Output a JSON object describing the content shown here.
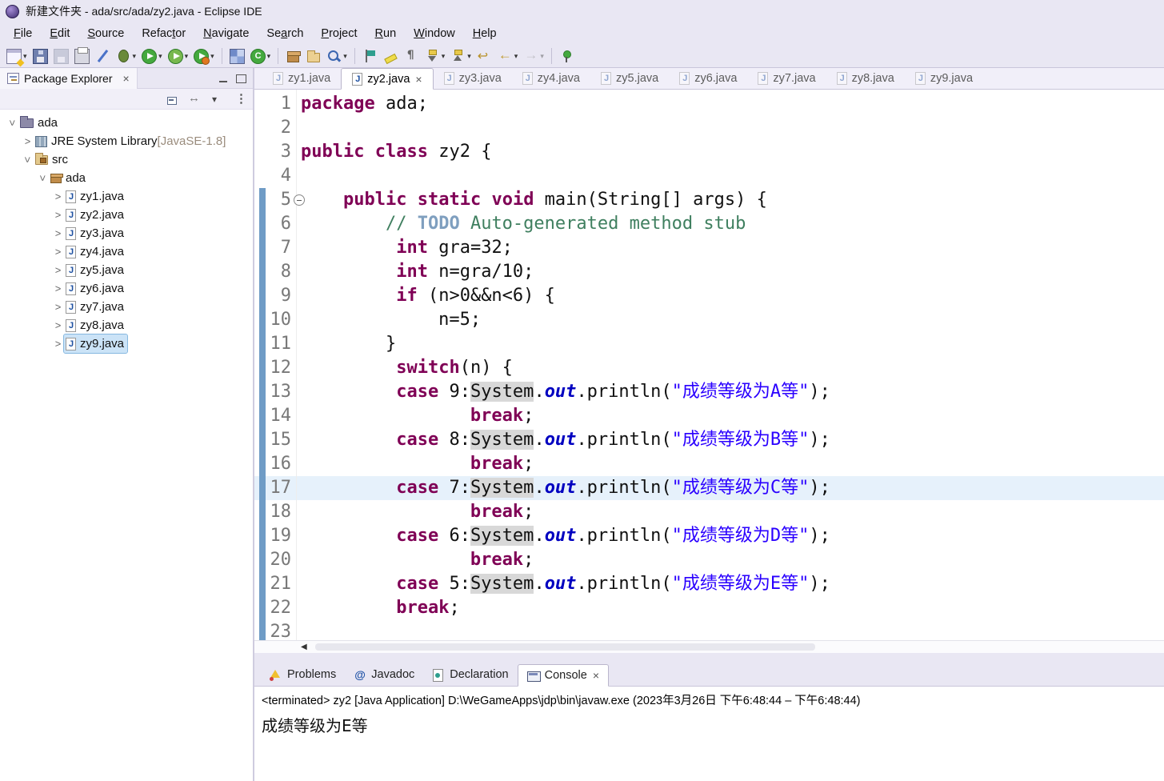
{
  "window": {
    "title": "新建文件夹 - ada/src/ada/zy2.java - Eclipse IDE"
  },
  "icons": {
    "close": "×",
    "dropdown": "▾",
    "expander": ">",
    "scroll_left": "◀"
  },
  "colors": {
    "keyword": "#7f0055",
    "string": "#2a00ff",
    "comment": "#3f7f5f",
    "task_tag": "#7f9fbf",
    "field": "#0000c0",
    "current_line": "#e6f1fb",
    "occurrence": "#d8d8d8",
    "chrome": "#e9e7f3"
  },
  "menubar": [
    {
      "label": "File",
      "m": 0
    },
    {
      "label": "Edit",
      "m": 0
    },
    {
      "label": "Source",
      "m": 0
    },
    {
      "label": "Refactor",
      "m": 5
    },
    {
      "label": "Navigate",
      "m": 0
    },
    {
      "label": "Search",
      "m": 2
    },
    {
      "label": "Project",
      "m": 0
    },
    {
      "label": "Run",
      "m": 0
    },
    {
      "label": "Window",
      "m": 0
    },
    {
      "label": "Help",
      "m": 0
    }
  ],
  "toolbar": [
    {
      "name": "new",
      "kind": "window",
      "dd": true
    },
    {
      "name": "save",
      "kind": "floppy"
    },
    {
      "name": "save-all",
      "kind": "floppy2",
      "disabled": true
    },
    {
      "name": "print",
      "kind": "printer"
    },
    {
      "name": "skip-all-breakpoints",
      "kind": "slash"
    },
    {
      "name": "debug",
      "kind": "bug",
      "dd": true
    },
    {
      "name": "run",
      "kind": "run",
      "dd": true
    },
    {
      "name": "coverage",
      "kind": "coverage",
      "dd": true
    },
    {
      "name": "profile",
      "kind": "profile",
      "dd": true
    },
    {
      "sep": true
    },
    {
      "name": "new-java-project",
      "kind": "grid"
    },
    {
      "name": "new-java-class",
      "kind": "class",
      "dd": true
    },
    {
      "sep": true
    },
    {
      "name": "new-package",
      "kind": "package"
    },
    {
      "name": "open-type",
      "kind": "folder"
    },
    {
      "name": "search",
      "kind": "search",
      "dd": true
    },
    {
      "sep": true
    },
    {
      "name": "open-perspective",
      "kind": "flag"
    },
    {
      "name": "mark-occurrences",
      "kind": "marker"
    },
    {
      "name": "show-whitespace",
      "kind": "pilcrow"
    },
    {
      "name": "next-annotation",
      "kind": "chevdown",
      "dd": true
    },
    {
      "name": "previous-annotation",
      "kind": "chevup",
      "dd": true
    },
    {
      "name": "last-edit-location",
      "kind": "undo"
    },
    {
      "name": "back",
      "kind": "arrowleft",
      "dd": true
    },
    {
      "name": "forward",
      "kind": "arrowright",
      "dd": true,
      "disabled": true
    },
    {
      "sep": true
    },
    {
      "name": "pin-editor",
      "kind": "pin"
    }
  ],
  "package_explorer": {
    "title": "Package Explorer",
    "tree": [
      {
        "label": "ada",
        "depth": 0,
        "exp": "open",
        "icon": "project"
      },
      {
        "label": "JRE System Library",
        "dec": " [JavaSE-1.8]",
        "depth": 1,
        "exp": "closed",
        "icon": "library"
      },
      {
        "label": "src",
        "depth": 1,
        "exp": "open",
        "icon": "srcfolder"
      },
      {
        "label": "ada",
        "depth": 2,
        "exp": "open",
        "icon": "package"
      },
      {
        "label": "zy1.java",
        "depth": 3,
        "exp": "closed",
        "icon": "jfile"
      },
      {
        "label": "zy2.java",
        "depth": 3,
        "exp": "closed",
        "icon": "jfile"
      },
      {
        "label": "zy3.java",
        "depth": 3,
        "exp": "closed",
        "icon": "jfile"
      },
      {
        "label": "zy4.java",
        "depth": 3,
        "exp": "closed",
        "icon": "jfile"
      },
      {
        "label": "zy5.java",
        "depth": 3,
        "exp": "closed",
        "icon": "jfile"
      },
      {
        "label": "zy6.java",
        "depth": 3,
        "exp": "closed",
        "icon": "jfile"
      },
      {
        "label": "zy7.java",
        "depth": 3,
        "exp": "closed",
        "icon": "jfile"
      },
      {
        "label": "zy8.java",
        "depth": 3,
        "exp": "closed",
        "icon": "jfile"
      },
      {
        "label": "zy9.java",
        "depth": 3,
        "exp": "closed",
        "icon": "jfile",
        "selected": true
      }
    ]
  },
  "editor": {
    "tabs": [
      {
        "label": "zy1.java"
      },
      {
        "label": "zy2.java",
        "active": true
      },
      {
        "label": "zy3.java"
      },
      {
        "label": "zy4.java"
      },
      {
        "label": "zy5.java"
      },
      {
        "label": "zy6.java"
      },
      {
        "label": "zy7.java"
      },
      {
        "label": "zy8.java"
      },
      {
        "label": "zy9.java"
      }
    ],
    "lines": [
      {
        "n": 1,
        "t": [
          [
            "kw",
            "package"
          ],
          [
            "p",
            " ada;"
          ]
        ]
      },
      {
        "n": 2,
        "t": []
      },
      {
        "n": 3,
        "t": [
          [
            "kw",
            "public"
          ],
          [
            "p",
            " "
          ],
          [
            "kw",
            "class"
          ],
          [
            "p",
            " zy2 {"
          ]
        ]
      },
      {
        "n": 4,
        "t": []
      },
      {
        "n": 5,
        "fold": true,
        "t": [
          [
            "p",
            "    "
          ],
          [
            "kw",
            "public"
          ],
          [
            "p",
            " "
          ],
          [
            "kw",
            "static"
          ],
          [
            "p",
            " "
          ],
          [
            "kw",
            "void"
          ],
          [
            "p",
            " main(String[] args) {"
          ]
        ]
      },
      {
        "n": 6,
        "t": [
          [
            "p",
            "        "
          ],
          [
            "cmt",
            "// "
          ],
          [
            "todo",
            "TODO"
          ],
          [
            "cmt",
            " Auto-generated method stub"
          ]
        ]
      },
      {
        "n": 7,
        "t": [
          [
            "p",
            "         "
          ],
          [
            "kw",
            "int"
          ],
          [
            "p",
            " gra=32;"
          ]
        ]
      },
      {
        "n": 8,
        "t": [
          [
            "p",
            "         "
          ],
          [
            "kw",
            "int"
          ],
          [
            "p",
            " n=gra/10;"
          ]
        ]
      },
      {
        "n": 9,
        "t": [
          [
            "p",
            "         "
          ],
          [
            "kw",
            "if"
          ],
          [
            "p",
            " (n>0&&n<6) {"
          ]
        ]
      },
      {
        "n": 10,
        "t": [
          [
            "p",
            "             n=5;"
          ]
        ]
      },
      {
        "n": 11,
        "t": [
          [
            "p",
            "        }"
          ]
        ]
      },
      {
        "n": 12,
        "t": [
          [
            "p",
            "         "
          ],
          [
            "kw",
            "switch"
          ],
          [
            "p",
            "(n) {"
          ]
        ]
      },
      {
        "n": 13,
        "t": [
          [
            "p",
            "         "
          ],
          [
            "kw",
            "case"
          ],
          [
            "p",
            " 9:"
          ],
          [
            "sys",
            "System"
          ],
          [
            "p",
            "."
          ],
          [
            "fld",
            "out"
          ],
          [
            "p",
            ".println("
          ],
          [
            "str",
            "\"成绩等级为A等\""
          ],
          [
            "p",
            ");"
          ]
        ]
      },
      {
        "n": 14,
        "t": [
          [
            "p",
            "                "
          ],
          [
            "kw",
            "break"
          ],
          [
            "p",
            ";"
          ]
        ]
      },
      {
        "n": 15,
        "t": [
          [
            "p",
            "         "
          ],
          [
            "kw",
            "case"
          ],
          [
            "p",
            " 8:"
          ],
          [
            "sys",
            "System"
          ],
          [
            "p",
            "."
          ],
          [
            "fld",
            "out"
          ],
          [
            "p",
            ".println("
          ],
          [
            "str",
            "\"成绩等级为B等\""
          ],
          [
            "p",
            ");"
          ]
        ]
      },
      {
        "n": 16,
        "t": [
          [
            "p",
            "                "
          ],
          [
            "kw",
            "break"
          ],
          [
            "p",
            ";"
          ]
        ]
      },
      {
        "n": 17,
        "current": true,
        "t": [
          [
            "p",
            "         "
          ],
          [
            "kw",
            "case"
          ],
          [
            "p",
            " 7:"
          ],
          [
            "sys",
            "System"
          ],
          [
            "p",
            "."
          ],
          [
            "fld",
            "out"
          ],
          [
            "p",
            ".println("
          ],
          [
            "str",
            "\"成绩等级为C等\""
          ],
          [
            "p",
            ");"
          ]
        ]
      },
      {
        "n": 18,
        "t": [
          [
            "p",
            "                "
          ],
          [
            "kw",
            "break"
          ],
          [
            "p",
            ";"
          ]
        ]
      },
      {
        "n": 19,
        "t": [
          [
            "p",
            "         "
          ],
          [
            "kw",
            "case"
          ],
          [
            "p",
            " 6:"
          ],
          [
            "sys",
            "System"
          ],
          [
            "p",
            "."
          ],
          [
            "fld",
            "out"
          ],
          [
            "p",
            ".println("
          ],
          [
            "str",
            "\"成绩等级为D等\""
          ],
          [
            "p",
            ");"
          ]
        ]
      },
      {
        "n": 20,
        "t": [
          [
            "p",
            "                "
          ],
          [
            "kw",
            "break"
          ],
          [
            "p",
            ";"
          ]
        ]
      },
      {
        "n": 21,
        "t": [
          [
            "p",
            "         "
          ],
          [
            "kw",
            "case"
          ],
          [
            "p",
            " 5:"
          ],
          [
            "sys",
            "System"
          ],
          [
            "p",
            "."
          ],
          [
            "fld",
            "out"
          ],
          [
            "p",
            ".println("
          ],
          [
            "str",
            "\"成绩等级为E等\""
          ],
          [
            "p",
            ");"
          ]
        ]
      },
      {
        "n": 22,
        "t": [
          [
            "p",
            "         "
          ],
          [
            "kw",
            "break"
          ],
          [
            "p",
            ";"
          ]
        ]
      },
      {
        "n": 23,
        "t": []
      }
    ]
  },
  "bottom": {
    "tabs": [
      {
        "label": "Problems",
        "icon": "problems"
      },
      {
        "label": "Javadoc",
        "icon": "javadoc"
      },
      {
        "label": "Declaration",
        "icon": "declaration"
      },
      {
        "label": "Console",
        "icon": "console",
        "active": true
      }
    ],
    "status_line": "<terminated> zy2 [Java Application] D:\\WeGameApps\\jdp\\bin\\javaw.exe  (2023年3月26日 下午6:48:44 – 下午6:48:44)",
    "output": "成绩等级为E等"
  }
}
